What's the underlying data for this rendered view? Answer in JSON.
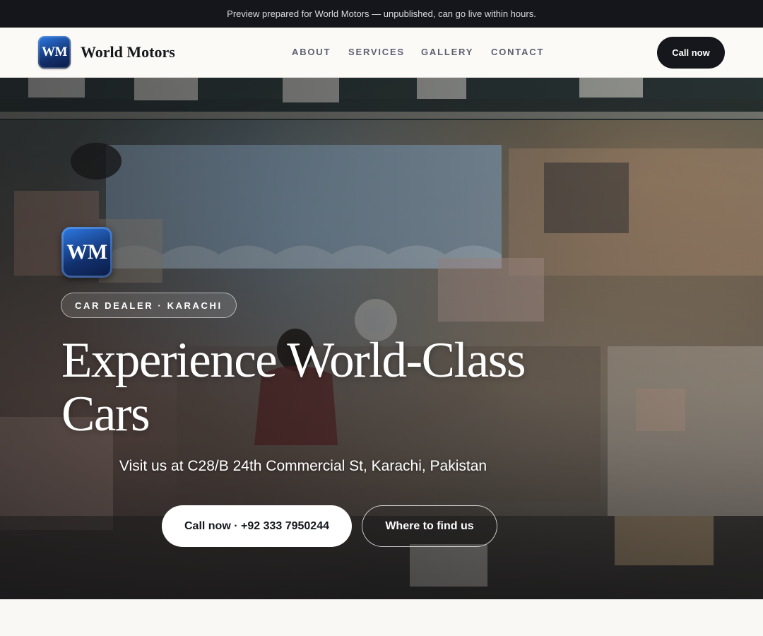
{
  "announcement": "Preview prepared for World Motors — unpublished, can go live within hours.",
  "header": {
    "logo_text": "WM",
    "brand_name": "World Motors",
    "nav": [
      "ABOUT",
      "SERVICES",
      "GALLERY",
      "CONTACT"
    ],
    "call_label": "Call now"
  },
  "hero": {
    "logo_text": "WM",
    "tag": "CAR DEALER · KARACHI",
    "title": "Experience World-Class Cars",
    "address": "Visit us at C28/B 24th Commercial St, Karachi, Pakistan",
    "primary_button": "Call now · +92 333 7950244",
    "secondary_button": "Where to find us"
  },
  "colors": {
    "dark": "#15171c",
    "topbar": "#14161c",
    "logo_blue": "#1b4fb0",
    "nav_text": "#5d6170",
    "page_bg": "#f9f8f5"
  }
}
